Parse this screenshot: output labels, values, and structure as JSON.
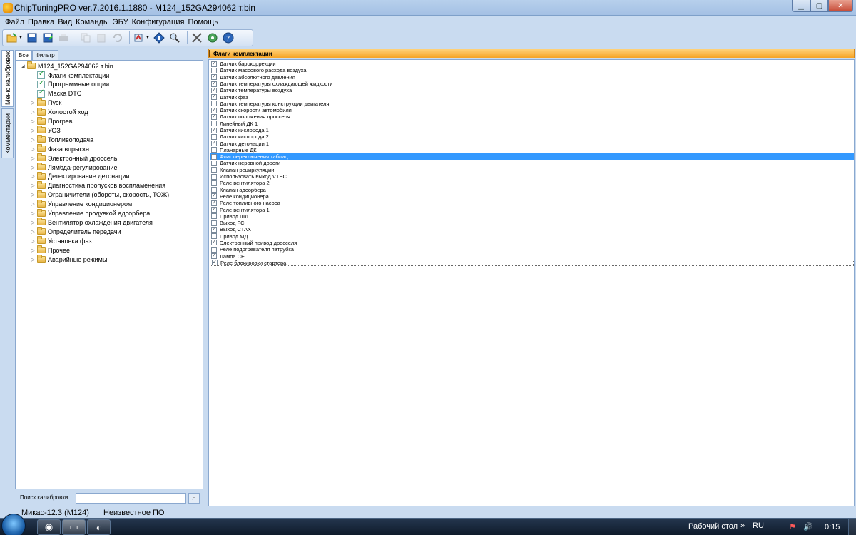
{
  "window": {
    "title": "ChipTuningPRO ver.7.2016.1.1880 - M124_152GA294062 т.bin",
    "minimize_glyph": "▁",
    "maximize_glyph": "▢",
    "close_glyph": "✕"
  },
  "menu": [
    "Файл",
    "Правка",
    "Вид",
    "Команды",
    "ЭБУ",
    "Конфигурация",
    "Помощь"
  ],
  "toolbar": {
    "icons": [
      "open-icon",
      "save-icon",
      "save-as-icon",
      "print-icon",
      "copy-icon",
      "paste-icon",
      "undo-icon",
      "ecu-read-icon",
      "diamond-info-icon",
      "search-map-icon",
      "tools-icon",
      "refresh-icon",
      "help-icon"
    ]
  },
  "side_tabs": {
    "menu": "Меню калибровок",
    "comments": "Комментарии"
  },
  "left_panel": {
    "tabs": [
      "Все",
      "Фильтр"
    ],
    "tree_root": "M124_152GA294062 т.bin",
    "tree_docs": [
      "Флаги комплектации",
      "Программные опции",
      "Маска DTC"
    ],
    "tree_folders": [
      "Пуск",
      "Холостой ход",
      "Прогрев",
      "УОЗ",
      "Топливоподача",
      "Фаза впрыска",
      "Электронный дроссель",
      "Лямбда-регулирование",
      "Детектирование детонации",
      "Диагностика пропусков воспламенения",
      "Ограничители (обороты, скорость, ТОЖ)",
      "Управление кондиционером",
      "Управление продувкой адсорбера",
      "Вентилятор охлаждения двигателя",
      "Определитель передачи",
      "Установка фаз",
      "Прочее",
      "Аварийные режимы"
    ],
    "search_label": "Поиск калибровки",
    "search_value": "",
    "search_button_glyph": "⌕"
  },
  "right_panel": {
    "header": "Флаги комплектации",
    "flags": [
      {
        "label": "Датчик барокоррекции",
        "checked": true
      },
      {
        "label": "Датчик массового расхода воздуха",
        "checked": false
      },
      {
        "label": "Датчик абсолютного давления",
        "checked": true
      },
      {
        "label": "Датчик температуры охлаждающей жидкости",
        "checked": true
      },
      {
        "label": "Датчик температуры воздуха",
        "checked": true
      },
      {
        "label": "Датчик фаз",
        "checked": true
      },
      {
        "label": "Датчик температуры конструкции двигателя",
        "checked": false
      },
      {
        "label": "Датчик скорости автомобиля",
        "checked": true
      },
      {
        "label": "Датчик положения дросселя",
        "checked": true
      },
      {
        "label": "Линейный ДК 1",
        "checked": false
      },
      {
        "label": "Датчик кислорода 1",
        "checked": true
      },
      {
        "label": "Датчик кислорода 2",
        "checked": false
      },
      {
        "label": "Датчик детонации 1",
        "checked": true
      },
      {
        "label": "Планарные ДК",
        "checked": false
      },
      {
        "label": "Флаг переключения таблиц",
        "checked": false,
        "selected": true
      },
      {
        "label": "Датчик неровной дороги",
        "checked": false
      },
      {
        "label": "Клапан рециркуляции",
        "checked": false
      },
      {
        "label": "Использовать выход VTEC",
        "checked": false
      },
      {
        "label": "Реле вентилятора 2",
        "checked": false
      },
      {
        "label": "Клапан адсорбера",
        "checked": false
      },
      {
        "label": "Реле кондиционера",
        "checked": true
      },
      {
        "label": "Реле топливного насоса",
        "checked": true
      },
      {
        "label": "Реле вентилятора 1",
        "checked": true
      },
      {
        "label": "Привод ШД",
        "checked": false
      },
      {
        "label": "Выход FCI",
        "checked": false
      },
      {
        "label": "Выход СТАХ",
        "checked": true
      },
      {
        "label": "Привод МД",
        "checked": false
      },
      {
        "label": "Электронный привод дросселя",
        "checked": true
      },
      {
        "label": "Реле подогревателя патрубка",
        "checked": false
      },
      {
        "label": "Лампа СЕ",
        "checked": true
      },
      {
        "label": "Реле блокировки стартера",
        "checked": true,
        "focus": true
      }
    ]
  },
  "status": {
    "left": "Микас-12.3 (M124)",
    "right": "Неизвестное ПО"
  },
  "taskbar": {
    "desktop_label": "Рабочий стол",
    "desktop_arrow": "»",
    "language": "RU",
    "clock": "0:15",
    "tray_flag_glyph": "⚑",
    "tray_sound_glyph": "🔊",
    "chrome_glyph": "◉",
    "app_glyph": "▭",
    "disk_glyph": "◐"
  }
}
